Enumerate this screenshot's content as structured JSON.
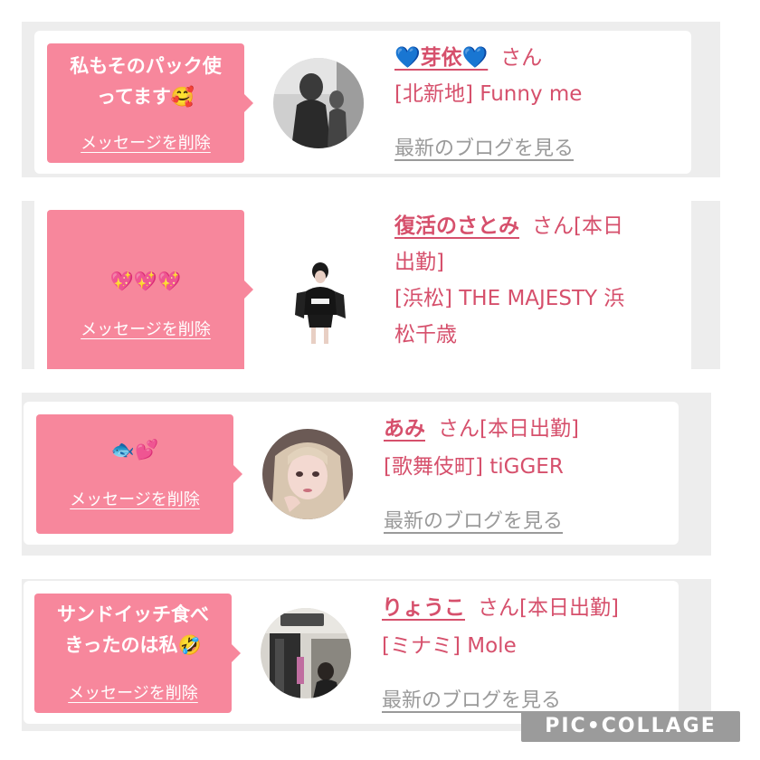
{
  "colors": {
    "bubble": "#f7879c",
    "name": "#d6506c",
    "blog_link": "#9a9a9a",
    "panel_bg": "#ededed"
  },
  "delete_label": "メッセージを削除",
  "blog_label": "最新のブログを見る",
  "entries": [
    {
      "message_line1": "私もそのパック使",
      "message_line2": "ってます",
      "message_emoji": "🥰",
      "name": "💙芽依💙",
      "honorific": "さん",
      "shop_line1": "[北新地] Funny me",
      "shop_line2": ""
    },
    {
      "message_emoji": "💖💖💖",
      "name": "復活のさとみ",
      "honorific": "さん[本日",
      "honorific_line2": "出勤]",
      "shop_line1": "[浜松] THE MAJESTY 浜",
      "shop_line2": "松千歳"
    },
    {
      "message_emoji": "🐟💕",
      "name": "あみ",
      "honorific": "さん[本日出勤]",
      "shop_line1": "[歌舞伎町] tiGGER"
    },
    {
      "message_line1": "サンドイッチ食べ",
      "message_line2": "きったのは私",
      "message_emoji": "🤣",
      "name": "りょうこ",
      "honorific": "さん[本日出勤]",
      "shop_line1": "[ミナミ] Mole"
    }
  ],
  "watermark": "PIC•COLLAGE"
}
